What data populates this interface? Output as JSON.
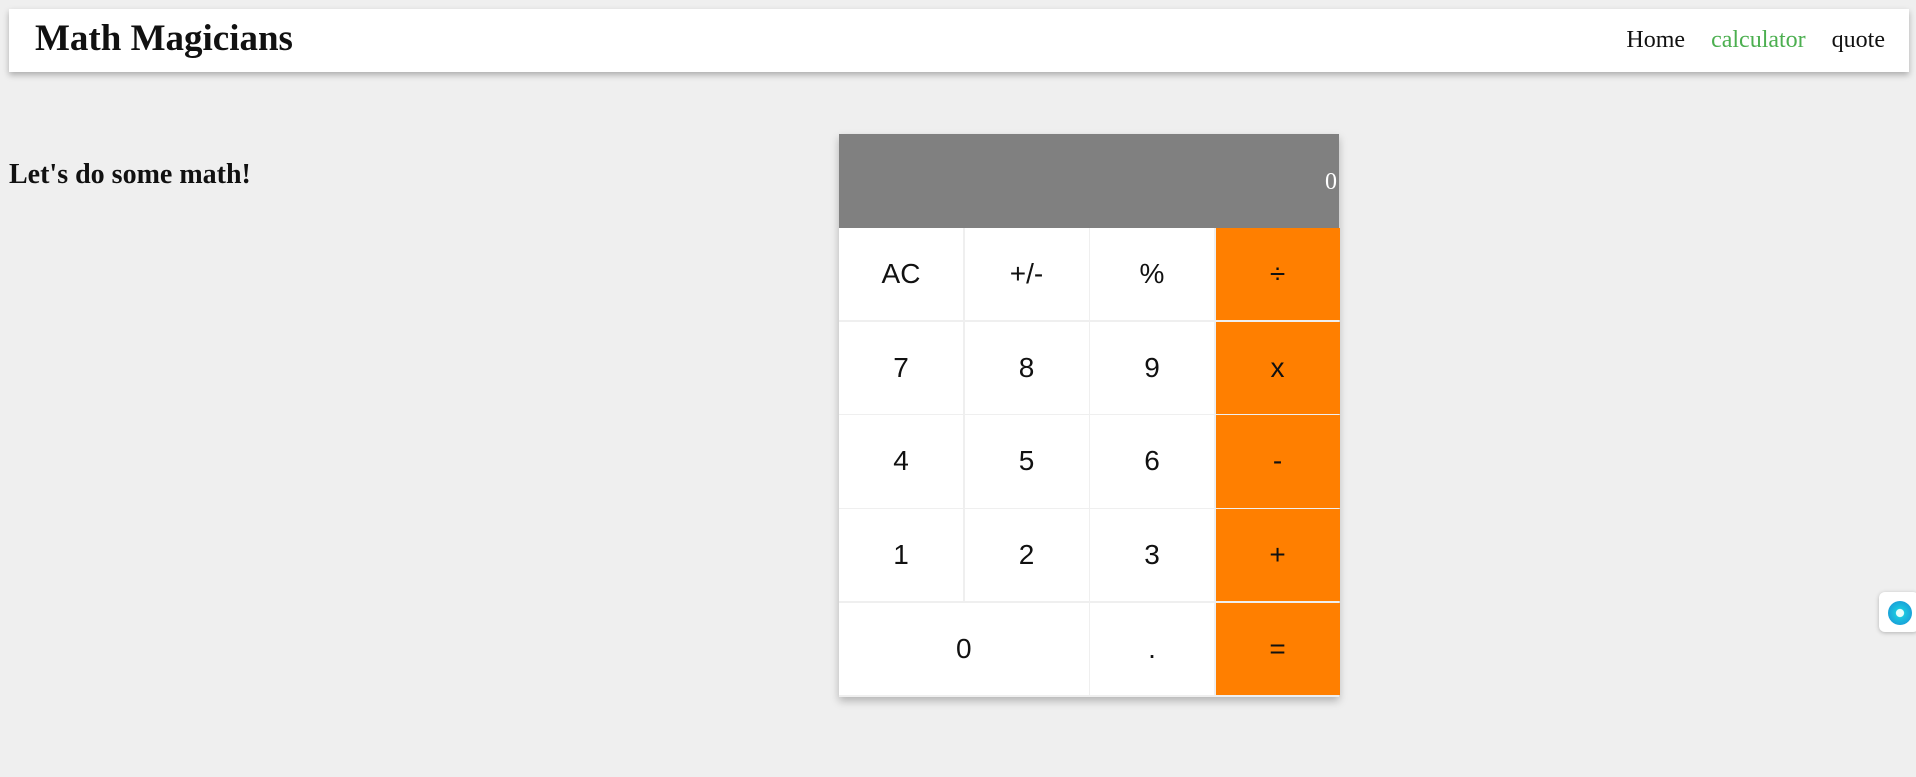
{
  "header": {
    "brand": "Math Magicians",
    "nav": [
      {
        "label": "Home",
        "active": false
      },
      {
        "label": "calculator",
        "active": true
      },
      {
        "label": "quote",
        "active": false
      }
    ]
  },
  "main": {
    "intro": "Let's do some math!"
  },
  "calculator": {
    "display": "0",
    "keys": [
      {
        "label": "AC",
        "type": "function"
      },
      {
        "label": "+/-",
        "type": "function"
      },
      {
        "label": "%",
        "type": "function"
      },
      {
        "label": "÷",
        "type": "operator"
      },
      {
        "label": "7",
        "type": "digit"
      },
      {
        "label": "8",
        "type": "digit"
      },
      {
        "label": "9",
        "type": "digit"
      },
      {
        "label": "x",
        "type": "operator"
      },
      {
        "label": "4",
        "type": "digit"
      },
      {
        "label": "5",
        "type": "digit"
      },
      {
        "label": "6",
        "type": "digit"
      },
      {
        "label": "-",
        "type": "operator"
      },
      {
        "label": "1",
        "type": "digit"
      },
      {
        "label": "2",
        "type": "digit"
      },
      {
        "label": "3",
        "type": "digit"
      },
      {
        "label": "+",
        "type": "operator"
      },
      {
        "label": "0",
        "type": "digit"
      },
      {
        "label": ".",
        "type": "digit"
      },
      {
        "label": "=",
        "type": "operator"
      }
    ]
  },
  "colors": {
    "background": "#efefef",
    "operator": "#ff7f00",
    "display": "#808080",
    "active_link": "#4caf50"
  },
  "widget": {
    "icon": "assistant-orb-icon"
  }
}
